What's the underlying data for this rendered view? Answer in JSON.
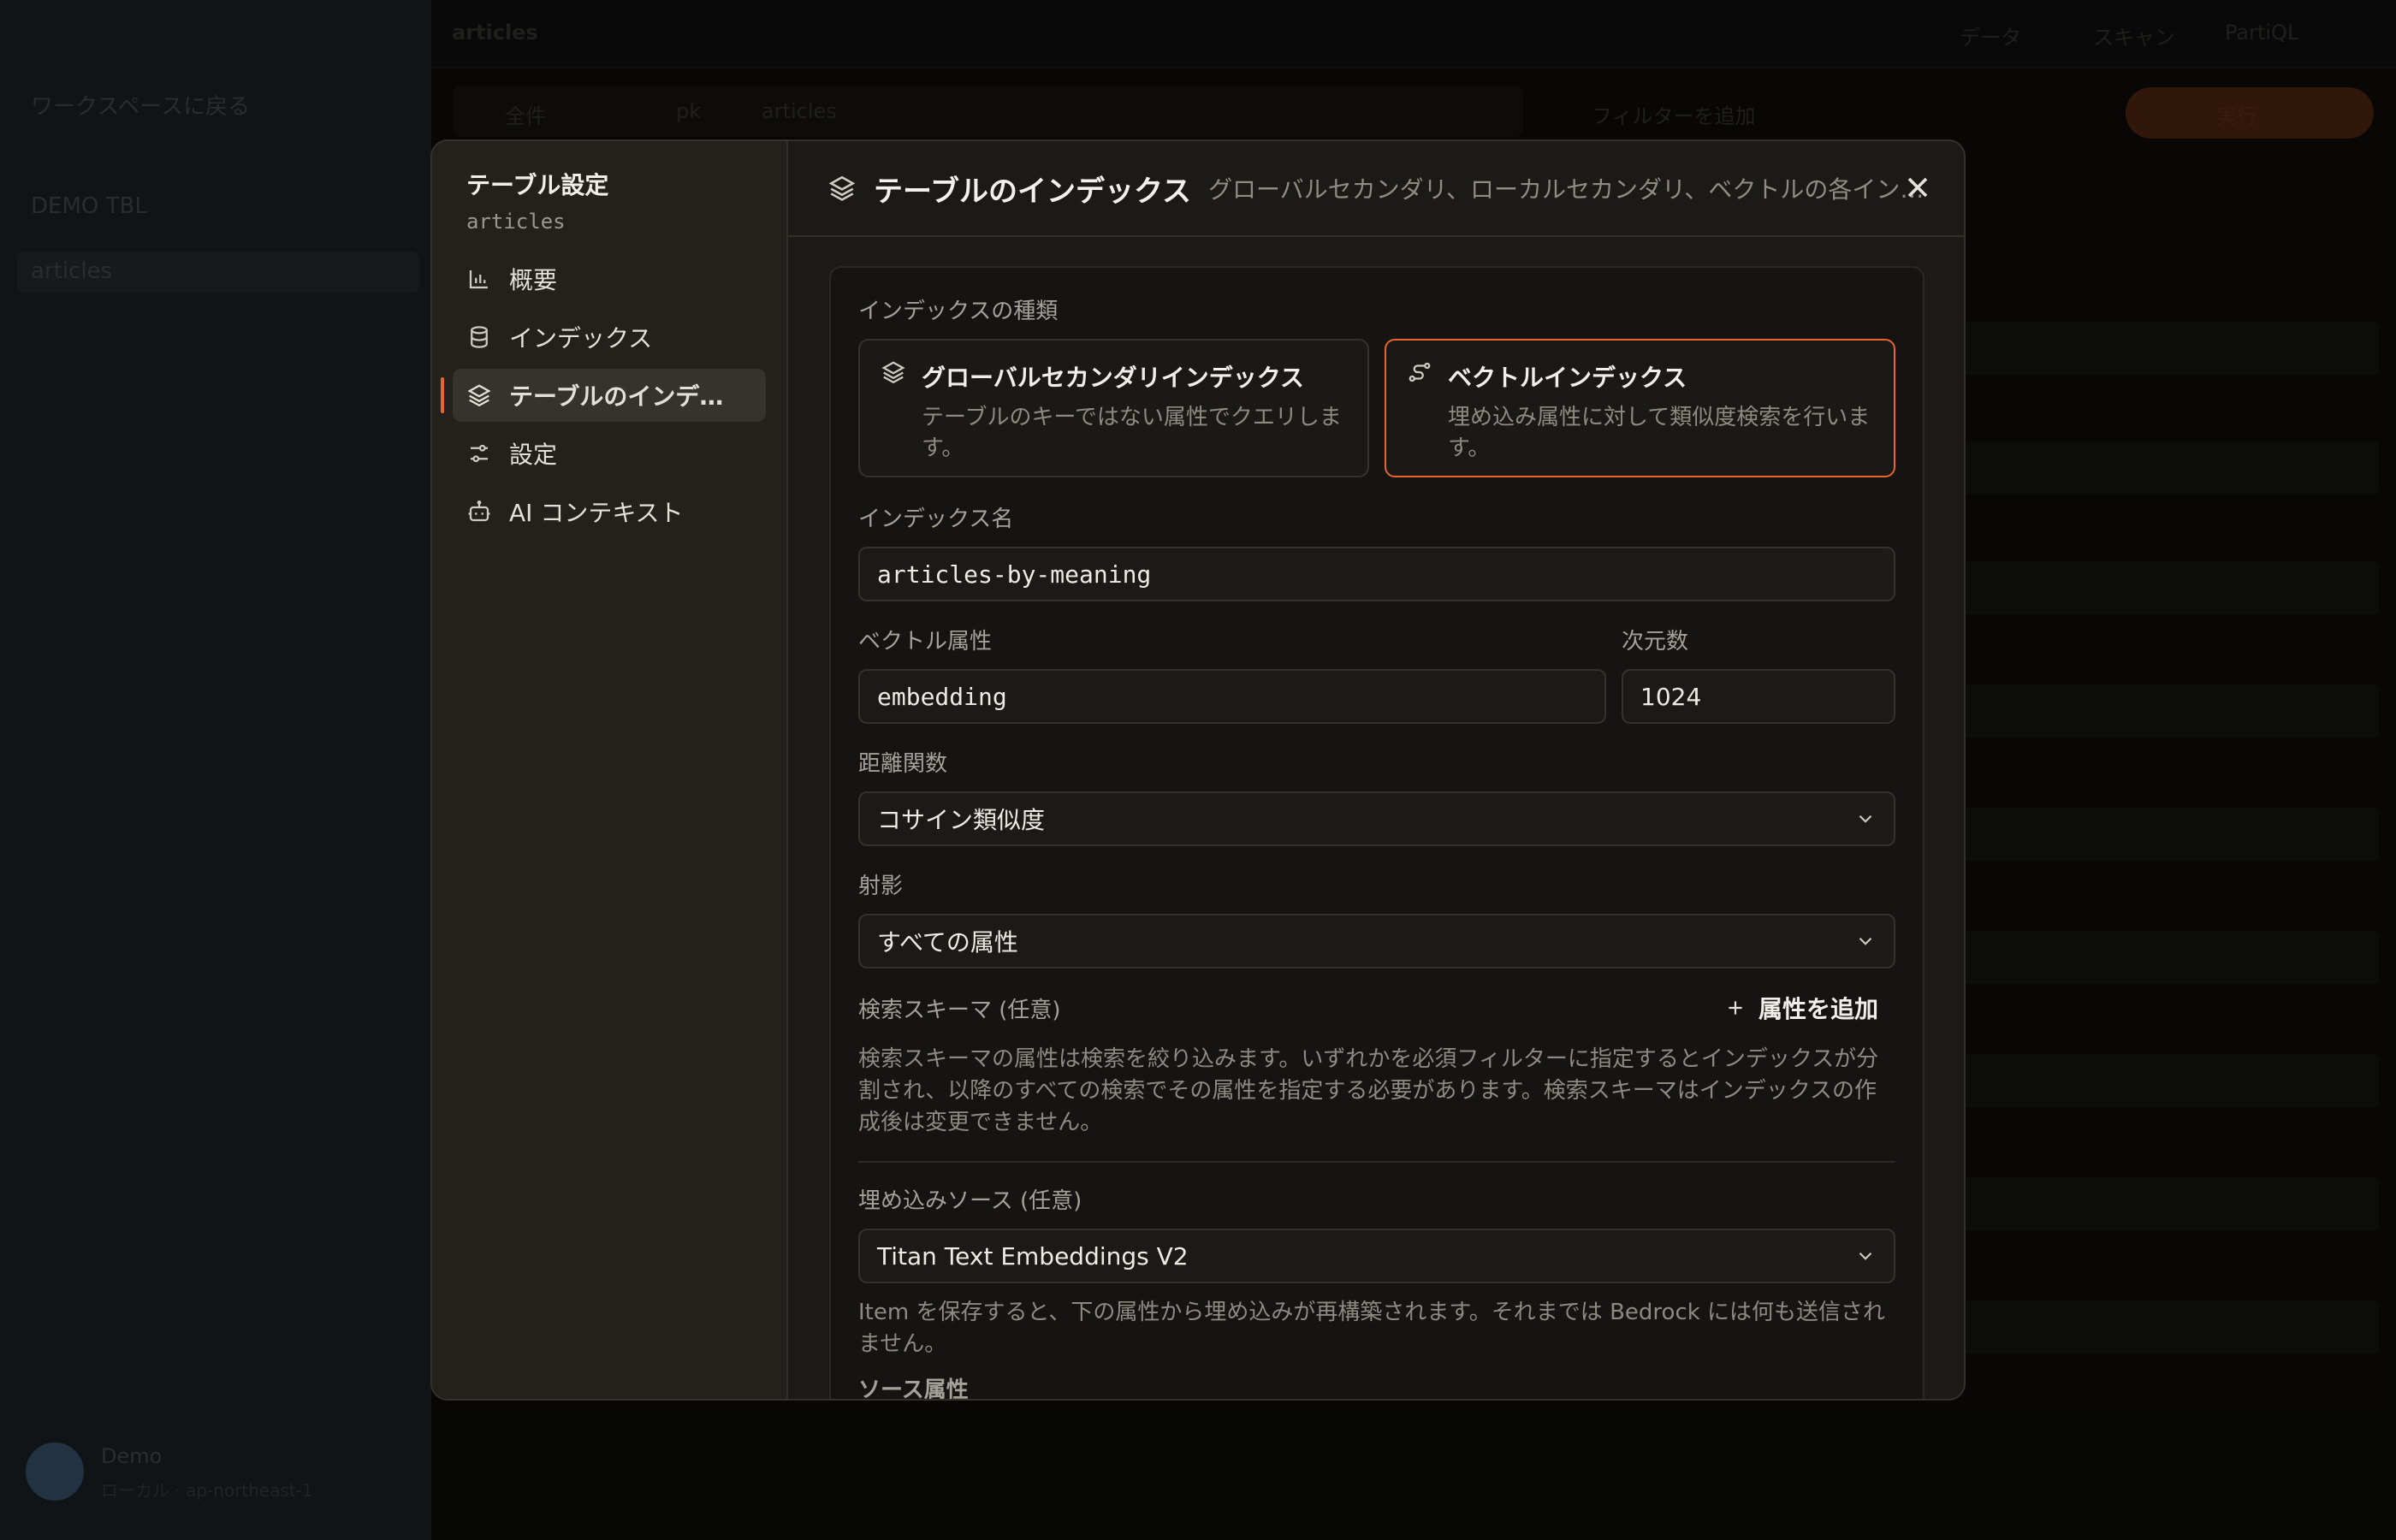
{
  "background": {
    "sidebar_back": "ワークスペースに戻る",
    "sidebar_item_1": "DEMO TBL",
    "sidebar_item_2": "articles",
    "user_name": "Demo",
    "user_sub": "ローカル · ap-northeast-1",
    "top_title": "articles",
    "top_right_1": "データ",
    "top_right_2": "スキャン",
    "top_right_3": "PartiQL",
    "filter_left": "全件",
    "filter_mid": "pk",
    "filter_value": "articles",
    "filter_right": "フィルターを追加",
    "run_label": "実行"
  },
  "modal": {
    "nav_title": "テーブル設定",
    "nav_table": "articles",
    "nav_items": [
      {
        "label": "概要",
        "icon": "bar-chart-icon"
      },
      {
        "label": "インデックス",
        "icon": "database-icon"
      },
      {
        "label": "テーブルのインデックス",
        "icon": "layers-icon"
      },
      {
        "label": "設定",
        "icon": "sliders-icon"
      },
      {
        "label": "AI コンテキスト",
        "icon": "robot-icon"
      }
    ],
    "header_title": "テーブルのインデックス",
    "header_desc": "グローバルセカンダリ、ローカルセカンダリ、ベクトルの各インデックス",
    "index_type_label": "インデックスの種類",
    "types": [
      {
        "title": "グローバルセカンダリインデックス",
        "desc": "テーブルのキーではない属性でクエリします。",
        "selected": false
      },
      {
        "title": "ベクトルインデックス",
        "desc": "埋め込み属性に対して類似度検索を行います。",
        "selected": true
      }
    ],
    "index_name_label": "インデックス名",
    "index_name_value": "articles-by-meaning",
    "vector_attr_label": "ベクトル属性",
    "vector_attr_value": "embedding",
    "dimensions_label": "次元数",
    "dimensions_value": "1024",
    "distance_label": "距離関数",
    "distance_value": "コサイン類似度",
    "projection_label": "射影",
    "projection_value": "すべての属性",
    "schema_label": "検索スキーマ (任意)",
    "add_attr_label": "属性を追加",
    "schema_help": "検索スキーマの属性は検索を絞り込みます。いずれかを必須フィルターに指定するとインデックスが分割され、以降のすべての検索でその属性を指定する必要があります。検索スキーマはインデックスの作成後は変更できません。",
    "embed_source_label": "埋め込みソース (任意)",
    "embed_source_value": "Titan Text Embeddings V2",
    "embed_help": "Item を保存すると、下の属性から埋め込みが再構築されます。それまでは Bedrock には何も送信されません。",
    "source_attr_label": "ソース属性"
  },
  "colors": {
    "accent": "#e8662a",
    "modal_bg": "#1c1a17",
    "nav_bg": "#24211c"
  }
}
